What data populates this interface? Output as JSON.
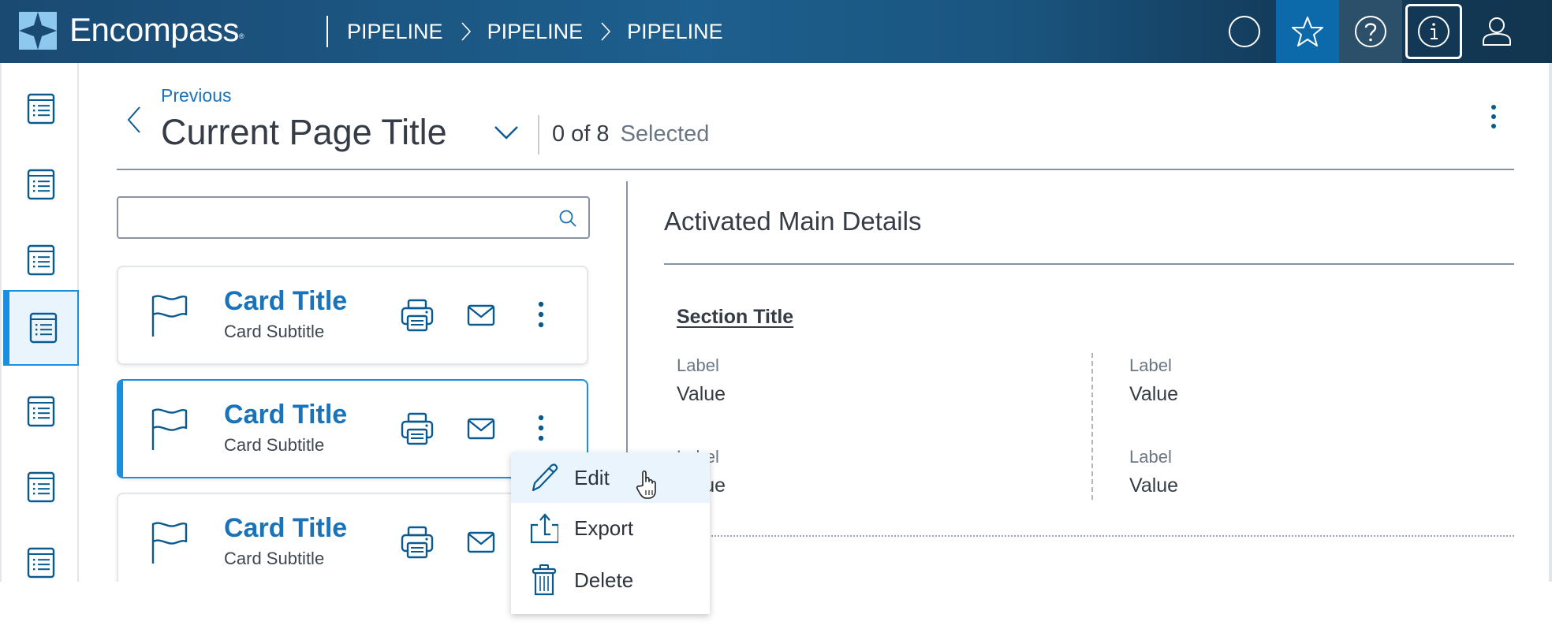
{
  "header": {
    "brand": "Encompass",
    "brand_mark": "®",
    "breadcrumbs": [
      "PIPELINE",
      "PIPELINE",
      "PIPELINE"
    ],
    "icons": [
      "circle-icon",
      "star-icon",
      "help-icon",
      "info-icon",
      "user-icon"
    ],
    "colors": {
      "star_bg": "#0d6aaa",
      "help_bg": "#2c5069"
    }
  },
  "leftnav": {
    "items": [
      {
        "icon": "list-icon",
        "active": false
      },
      {
        "icon": "list-icon",
        "active": false
      },
      {
        "icon": "list-icon",
        "active": false
      },
      {
        "icon": "list-icon",
        "active": true
      },
      {
        "icon": "list-icon",
        "active": false
      },
      {
        "icon": "list-icon",
        "active": false
      },
      {
        "icon": "list-icon",
        "active": false
      }
    ]
  },
  "page": {
    "previous_label": "Previous",
    "title": "Current Page Title",
    "count": "0 of 8",
    "selected_label": "Selected"
  },
  "search": {
    "value": "",
    "placeholder": ""
  },
  "cards": [
    {
      "title": "Card Title",
      "subtitle": "Card Subtitle",
      "selected": false
    },
    {
      "title": "Card Title",
      "subtitle": "Card Subtitle",
      "selected": true
    },
    {
      "title": "Card Title",
      "subtitle": "Card Subtitle",
      "selected": false
    }
  ],
  "details": {
    "title": "Activated Main Details",
    "section_title": "Section Title",
    "fields": [
      {
        "label": "Label",
        "value": "Value"
      },
      {
        "label": "Label",
        "value": "Value"
      },
      {
        "label": "Label",
        "value": "Value"
      },
      {
        "label": "Label",
        "value": "Value"
      }
    ]
  },
  "context_menu": {
    "items": [
      {
        "label": "Edit",
        "icon": "pencil-icon",
        "hovered": true
      },
      {
        "label": "Export",
        "icon": "export-icon",
        "hovered": false
      },
      {
        "label": "Delete",
        "icon": "trash-icon",
        "hovered": false
      }
    ]
  },
  "colors": {
    "accent": "#1a8fe0",
    "link": "#1a73b8",
    "icon": "#0b5a8f",
    "text": "#353c45",
    "muted": "#6b7684"
  }
}
